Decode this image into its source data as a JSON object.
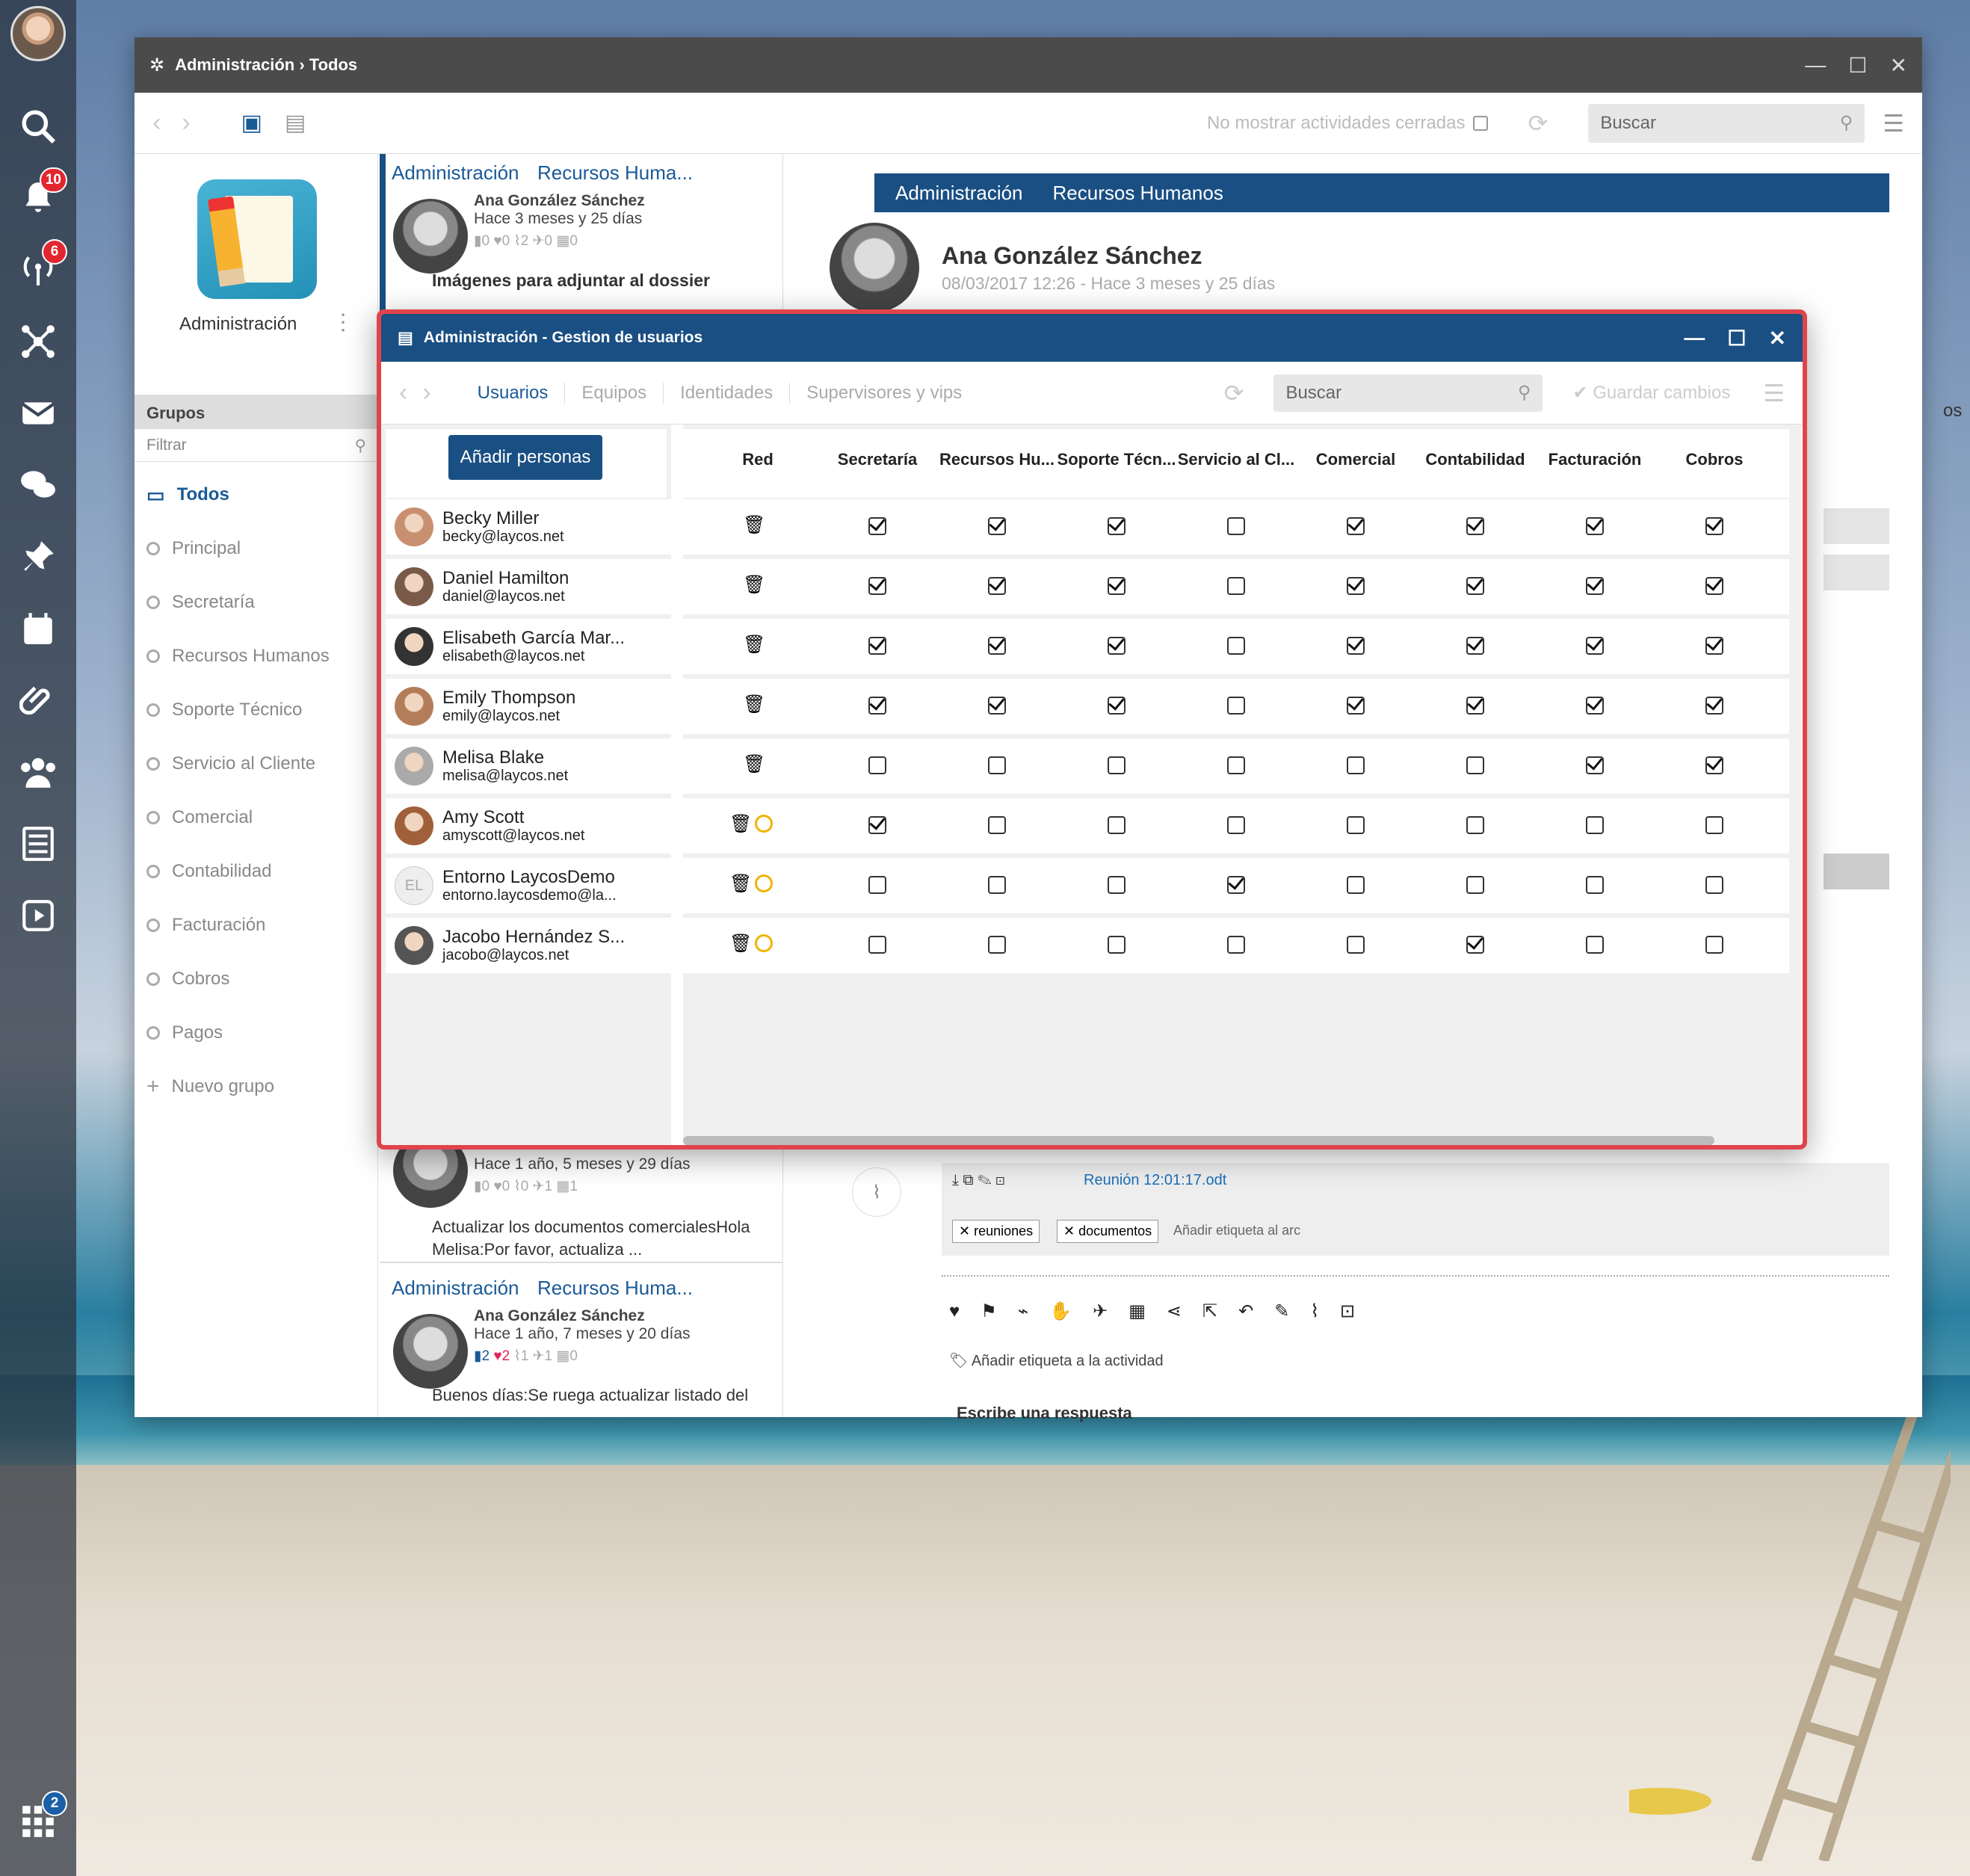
{
  "dock": {
    "notifications_badge": "10",
    "radio_badge": "6",
    "apps_badge": "2",
    "icons": [
      "search-icon",
      "bell-icon",
      "broadcast-icon",
      "network-icon",
      "mail-icon",
      "chat-icon",
      "pin-icon",
      "calendar-icon",
      "paperclip-icon",
      "group-icon",
      "list-icon",
      "play-icon",
      "apps-icon"
    ]
  },
  "window": {
    "title": "Administración › Todos",
    "toolbar": {
      "closed_label": "No mostrar actividades cerradas",
      "search_placeholder": "Buscar"
    }
  },
  "left": {
    "app_name": "Administración",
    "groups_title": "Grupos",
    "filter_placeholder": "Filtrar",
    "groups": [
      "Todos",
      "Principal",
      "Secretaría",
      "Recursos Humanos",
      "Soporte Técnico",
      "Servicio al Cliente",
      "Comercial",
      "Contabilidad",
      "Facturación",
      "Cobros",
      "Pagos",
      "Nuevo grupo"
    ]
  },
  "middle": {
    "card1": {
      "tag1": "Administración",
      "tag2": "Recursos Huma...",
      "author": "Ana González Sánchez",
      "time": "Hace 3 meses y 25 días",
      "counts": [
        "0",
        "0",
        "2",
        "0",
        "0"
      ],
      "title": "Imágenes para adjuntar al dossier"
    },
    "card2": {
      "time": "Hace 1 año, 5 meses y 29 días",
      "counts": [
        "0",
        "0",
        "0",
        "1",
        "1"
      ],
      "text": "Actualizar los documentos comercialesHola Melisa:Por favor, actualiza ..."
    },
    "card3": {
      "tag1": "Administración",
      "tag2": "Recursos Huma...",
      "author": "Ana González Sánchez",
      "time": "Hace 1 año, 7 meses y 20 días",
      "counts": [
        "2",
        "2",
        "1",
        "1",
        "0"
      ],
      "text": "Buenos días:Se ruega actualizar listado del"
    }
  },
  "right": {
    "tag1": "Administración",
    "tag2": "Recursos Humanos",
    "author": "Ana González Sánchez",
    "date": "08/03/2017 12:26 - Hace 3 meses y 25 días",
    "file": "Reunión 12:01:17.odt",
    "labels": [
      "reuniones",
      "documentos"
    ],
    "add_label_file": "Añadir etiqueta al arc",
    "add_label_activity": "Añadir etiqueta a la actividad",
    "reply_placeholder": "Escribe una respuesta",
    "cut_text": "os"
  },
  "modal": {
    "title": "Administración - Gestion de usuarios",
    "tabs": [
      "Usuarios",
      "Equipos",
      "Identidades",
      "Supervisores y vips"
    ],
    "search_placeholder": "Buscar",
    "save_label": "Guardar cambios",
    "add_button": "Añadir personas",
    "columns": [
      "Red",
      "Secretaría",
      "Recursos Hu...",
      "Soporte Técn...",
      "Servicio al Cl...",
      "Comercial",
      "Contabilidad",
      "Facturación",
      "Cobros"
    ],
    "users": [
      {
        "name": "Becky Miller",
        "email": "becky@laycos.net",
        "pending": false,
        "checks": [
          1,
          1,
          1,
          0,
          1,
          1,
          1,
          1
        ]
      },
      {
        "name": "Daniel Hamilton",
        "email": "daniel@laycos.net",
        "pending": false,
        "checks": [
          1,
          1,
          1,
          0,
          1,
          1,
          1,
          1
        ]
      },
      {
        "name": "Elisabeth García Mar...",
        "email": "elisabeth@laycos.net",
        "pending": false,
        "checks": [
          1,
          1,
          1,
          0,
          1,
          1,
          1,
          1
        ]
      },
      {
        "name": "Emily Thompson",
        "email": "emily@laycos.net",
        "pending": false,
        "checks": [
          1,
          1,
          1,
          0,
          1,
          1,
          1,
          1
        ]
      },
      {
        "name": "Melisa Blake",
        "email": "melisa@laycos.net",
        "pending": false,
        "checks": [
          0,
          0,
          0,
          0,
          0,
          0,
          1,
          1
        ]
      },
      {
        "name": "Amy Scott",
        "email": "amyscott@laycos.net",
        "pending": true,
        "checks": [
          1,
          0,
          0,
          0,
          0,
          0,
          0,
          0
        ]
      },
      {
        "name": "Entorno LaycosDemo",
        "email": "entorno.laycosdemo@la...",
        "pending": true,
        "initials": "EL",
        "checks": [
          0,
          0,
          0,
          1,
          0,
          0,
          0,
          0
        ]
      },
      {
        "name": "Jacobo Hernández S...",
        "email": "jacobo@laycos.net",
        "pending": true,
        "checks": [
          0,
          0,
          0,
          0,
          0,
          1,
          0,
          0
        ]
      }
    ]
  }
}
